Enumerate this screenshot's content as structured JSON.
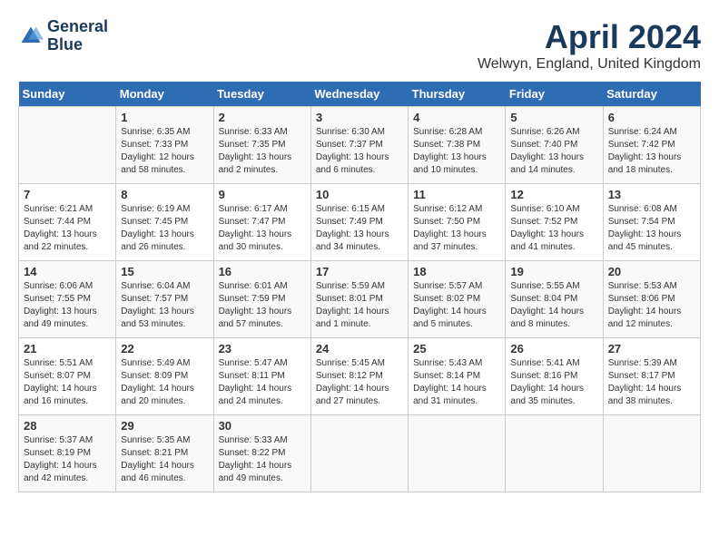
{
  "header": {
    "logo_line1": "General",
    "logo_line2": "Blue",
    "month_year": "April 2024",
    "location": "Welwyn, England, United Kingdom"
  },
  "days_of_week": [
    "Sunday",
    "Monday",
    "Tuesday",
    "Wednesday",
    "Thursday",
    "Friday",
    "Saturday"
  ],
  "weeks": [
    [
      {
        "day": "",
        "content": ""
      },
      {
        "day": "1",
        "content": "Sunrise: 6:35 AM\nSunset: 7:33 PM\nDaylight: 12 hours\nand 58 minutes."
      },
      {
        "day": "2",
        "content": "Sunrise: 6:33 AM\nSunset: 7:35 PM\nDaylight: 13 hours\nand 2 minutes."
      },
      {
        "day": "3",
        "content": "Sunrise: 6:30 AM\nSunset: 7:37 PM\nDaylight: 13 hours\nand 6 minutes."
      },
      {
        "day": "4",
        "content": "Sunrise: 6:28 AM\nSunset: 7:38 PM\nDaylight: 13 hours\nand 10 minutes."
      },
      {
        "day": "5",
        "content": "Sunrise: 6:26 AM\nSunset: 7:40 PM\nDaylight: 13 hours\nand 14 minutes."
      },
      {
        "day": "6",
        "content": "Sunrise: 6:24 AM\nSunset: 7:42 PM\nDaylight: 13 hours\nand 18 minutes."
      }
    ],
    [
      {
        "day": "7",
        "content": "Sunrise: 6:21 AM\nSunset: 7:44 PM\nDaylight: 13 hours\nand 22 minutes."
      },
      {
        "day": "8",
        "content": "Sunrise: 6:19 AM\nSunset: 7:45 PM\nDaylight: 13 hours\nand 26 minutes."
      },
      {
        "day": "9",
        "content": "Sunrise: 6:17 AM\nSunset: 7:47 PM\nDaylight: 13 hours\nand 30 minutes."
      },
      {
        "day": "10",
        "content": "Sunrise: 6:15 AM\nSunset: 7:49 PM\nDaylight: 13 hours\nand 34 minutes."
      },
      {
        "day": "11",
        "content": "Sunrise: 6:12 AM\nSunset: 7:50 PM\nDaylight: 13 hours\nand 37 minutes."
      },
      {
        "day": "12",
        "content": "Sunrise: 6:10 AM\nSunset: 7:52 PM\nDaylight: 13 hours\nand 41 minutes."
      },
      {
        "day": "13",
        "content": "Sunrise: 6:08 AM\nSunset: 7:54 PM\nDaylight: 13 hours\nand 45 minutes."
      }
    ],
    [
      {
        "day": "14",
        "content": "Sunrise: 6:06 AM\nSunset: 7:55 PM\nDaylight: 13 hours\nand 49 minutes."
      },
      {
        "day": "15",
        "content": "Sunrise: 6:04 AM\nSunset: 7:57 PM\nDaylight: 13 hours\nand 53 minutes."
      },
      {
        "day": "16",
        "content": "Sunrise: 6:01 AM\nSunset: 7:59 PM\nDaylight: 13 hours\nand 57 minutes."
      },
      {
        "day": "17",
        "content": "Sunrise: 5:59 AM\nSunset: 8:01 PM\nDaylight: 14 hours\nand 1 minute."
      },
      {
        "day": "18",
        "content": "Sunrise: 5:57 AM\nSunset: 8:02 PM\nDaylight: 14 hours\nand 5 minutes."
      },
      {
        "day": "19",
        "content": "Sunrise: 5:55 AM\nSunset: 8:04 PM\nDaylight: 14 hours\nand 8 minutes."
      },
      {
        "day": "20",
        "content": "Sunrise: 5:53 AM\nSunset: 8:06 PM\nDaylight: 14 hours\nand 12 minutes."
      }
    ],
    [
      {
        "day": "21",
        "content": "Sunrise: 5:51 AM\nSunset: 8:07 PM\nDaylight: 14 hours\nand 16 minutes."
      },
      {
        "day": "22",
        "content": "Sunrise: 5:49 AM\nSunset: 8:09 PM\nDaylight: 14 hours\nand 20 minutes."
      },
      {
        "day": "23",
        "content": "Sunrise: 5:47 AM\nSunset: 8:11 PM\nDaylight: 14 hours\nand 24 minutes."
      },
      {
        "day": "24",
        "content": "Sunrise: 5:45 AM\nSunset: 8:12 PM\nDaylight: 14 hours\nand 27 minutes."
      },
      {
        "day": "25",
        "content": "Sunrise: 5:43 AM\nSunset: 8:14 PM\nDaylight: 14 hours\nand 31 minutes."
      },
      {
        "day": "26",
        "content": "Sunrise: 5:41 AM\nSunset: 8:16 PM\nDaylight: 14 hours\nand 35 minutes."
      },
      {
        "day": "27",
        "content": "Sunrise: 5:39 AM\nSunset: 8:17 PM\nDaylight: 14 hours\nand 38 minutes."
      }
    ],
    [
      {
        "day": "28",
        "content": "Sunrise: 5:37 AM\nSunset: 8:19 PM\nDaylight: 14 hours\nand 42 minutes."
      },
      {
        "day": "29",
        "content": "Sunrise: 5:35 AM\nSunset: 8:21 PM\nDaylight: 14 hours\nand 46 minutes."
      },
      {
        "day": "30",
        "content": "Sunrise: 5:33 AM\nSunset: 8:22 PM\nDaylight: 14 hours\nand 49 minutes."
      },
      {
        "day": "",
        "content": ""
      },
      {
        "day": "",
        "content": ""
      },
      {
        "day": "",
        "content": ""
      },
      {
        "day": "",
        "content": ""
      }
    ]
  ]
}
